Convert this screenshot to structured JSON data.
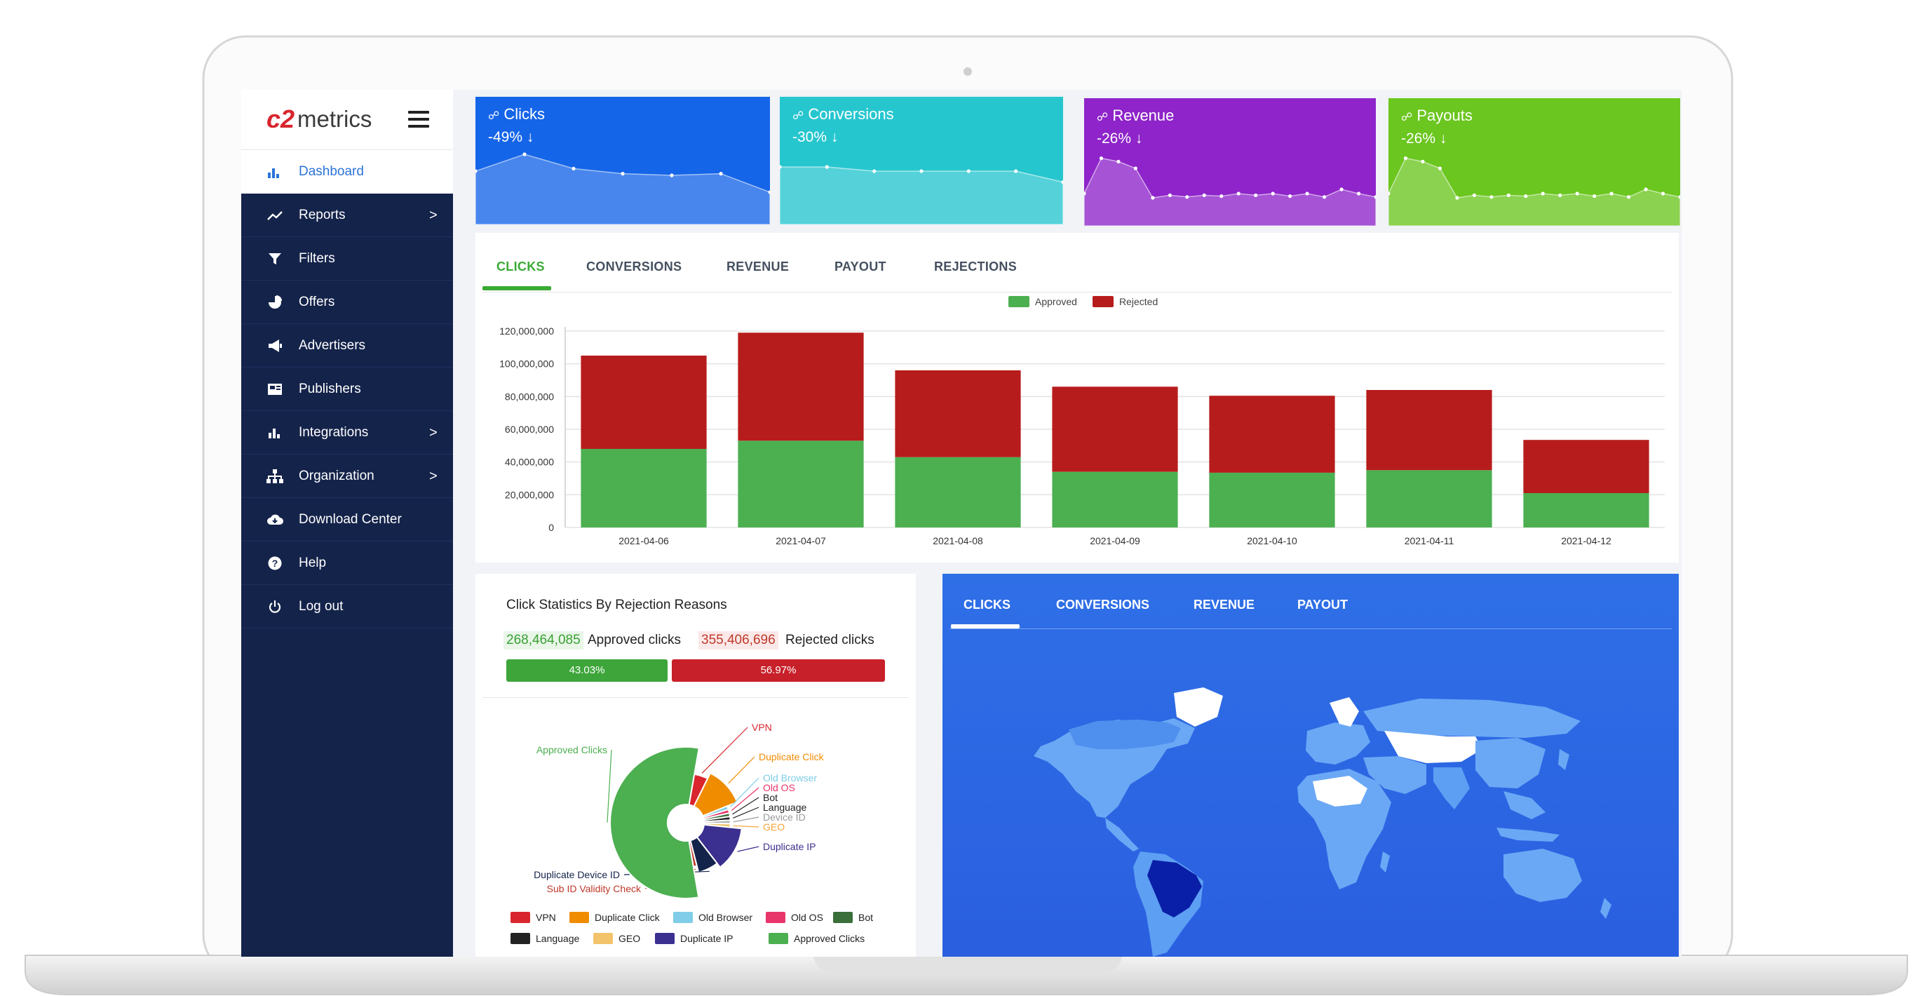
{
  "brand": {
    "mark": "c2",
    "word": "metrics"
  },
  "sidebar": {
    "active": "Dashboard",
    "items": [
      {
        "label": "Reports",
        "icon": "trend-icon",
        "chevron": ">"
      },
      {
        "label": "Filters",
        "icon": "filter-icon",
        "chevron": ""
      },
      {
        "label": "Offers",
        "icon": "pie-icon",
        "chevron": ""
      },
      {
        "label": "Advertisers",
        "icon": "megaphone-icon",
        "chevron": ""
      },
      {
        "label": "Publishers",
        "icon": "newspaper-icon",
        "chevron": ""
      },
      {
        "label": "Integrations",
        "icon": "bar-icon",
        "chevron": ">"
      },
      {
        "label": "Organization",
        "icon": "sitemap-icon",
        "chevron": ">"
      },
      {
        "label": "Download Center",
        "icon": "cloud-download-icon",
        "chevron": ""
      },
      {
        "label": "Help",
        "icon": "question-icon",
        "chevron": ""
      },
      {
        "label": "Log out",
        "icon": "power-icon",
        "chevron": ""
      }
    ]
  },
  "kpis": [
    {
      "title": "Clicks",
      "delta": "-49% ↓",
      "color": "#1565e8",
      "spark": [
        0.55,
        0.75,
        0.58,
        0.52,
        0.5,
        0.52,
        0.3
      ]
    },
    {
      "title": "Conversions",
      "delta": "-30% ↓",
      "color": "#26c6cf",
      "spark": [
        0.6,
        0.6,
        0.55,
        0.55,
        0.55,
        0.55,
        0.42
      ]
    },
    {
      "title": "Revenue",
      "delta": "-26% ↓",
      "color": "#8e24c9",
      "spark": [
        0.3,
        0.72,
        0.68,
        0.6,
        0.25,
        0.28,
        0.26,
        0.28,
        0.27,
        0.3,
        0.28,
        0.3,
        0.27,
        0.3,
        0.26,
        0.35,
        0.3,
        0.26
      ]
    },
    {
      "title": "Payouts",
      "delta": "-26% ↓",
      "color": "#6bc61f",
      "spark": [
        0.3,
        0.72,
        0.68,
        0.6,
        0.25,
        0.28,
        0.26,
        0.28,
        0.27,
        0.3,
        0.28,
        0.3,
        0.27,
        0.3,
        0.26,
        0.35,
        0.3,
        0.26
      ]
    }
  ],
  "tabs": {
    "items": [
      "CLICKS",
      "CONVERSIONS",
      "REVENUE",
      "PAYOUT",
      "REJECTIONS"
    ],
    "active": "CLICKS",
    "accent": "#3aaa35"
  },
  "chart_data": {
    "type": "bar",
    "stacked": true,
    "categories": [
      "2021-04-06",
      "2021-04-07",
      "2021-04-08",
      "2021-04-09",
      "2021-04-10",
      "2021-04-11",
      "2021-04-12"
    ],
    "series": [
      {
        "name": "Approved",
        "color": "#4caf50",
        "values": [
          48000000,
          53000000,
          43000000,
          34000000,
          33500000,
          35000000,
          21000000
        ]
      },
      {
        "name": "Rejected",
        "color": "#b71c1c",
        "values": [
          57000000,
          66000000,
          53000000,
          52000000,
          47000000,
          49000000,
          32500000
        ]
      }
    ],
    "ylim": [
      0,
      120000000
    ],
    "yticks": [
      "0",
      "20,000,000",
      "40,000,000",
      "60,000,000",
      "80,000,000",
      "100,000,000",
      "120,000,000"
    ],
    "legend": "top-center",
    "grid": true
  },
  "rejection": {
    "title": "Click Statistics By Rejection Reasons",
    "approved_count": "268,464,085",
    "approved_label": "Approved clicks",
    "rejected_count": "355,406,696",
    "rejected_label": "Rejected clicks",
    "approved_pct": "43.03%",
    "rejected_pct": "56.97%",
    "approved_fraction": 0.4303,
    "pie": [
      {
        "name": "VPN",
        "color": "#d9262e",
        "value": 3.5,
        "label_color": "#d9262e"
      },
      {
        "name": "Duplicate Click",
        "color": "#f08c00",
        "value": 9,
        "label_color": "#f08c00"
      },
      {
        "name": "Old Browser",
        "color": "#7fcde8",
        "value": 1,
        "label_color": "#7fcde8"
      },
      {
        "name": "Old OS",
        "color": "#e8356a",
        "value": 1,
        "label_color": "#e8356a"
      },
      {
        "name": "Bot",
        "color": "#3a6e3a",
        "value": 1,
        "label_color": "#222222"
      },
      {
        "name": "Language",
        "color": "#222222",
        "value": 1,
        "label_color": "#222222"
      },
      {
        "name": "Device ID",
        "color": "#b5b5b5",
        "value": 1,
        "label_color": "#9a9a9a"
      },
      {
        "name": "GEO",
        "color": "#f2c36b",
        "value": 1,
        "label_color": "#f2a43a"
      },
      {
        "name": "Duplicate IP",
        "color": "#3b2f8f",
        "value": 10,
        "label_color": "#3b2f8f"
      },
      {
        "name": "Duplicate Device ID",
        "color": "#14234a",
        "value": 5,
        "label_color": "#14234a"
      },
      {
        "name": "Sub ID Validity Check",
        "color": "#c0392b",
        "value": 1,
        "label_color": "#c0392b"
      },
      {
        "name": "Approved Clicks",
        "color": "#4caf50",
        "value": 43,
        "label_color": "#4caf50"
      }
    ],
    "legend": [
      {
        "name": "VPN",
        "color": "#d9262e"
      },
      {
        "name": "Duplicate Click",
        "color": "#f08c00"
      },
      {
        "name": "Old Browser",
        "color": "#7fcde8"
      },
      {
        "name": "Old OS",
        "color": "#e8356a"
      },
      {
        "name": "Bot",
        "color": "#3a6e3a"
      },
      {
        "name": "Language",
        "color": "#222222"
      },
      {
        "name": "GEO",
        "color": "#f2c36b"
      },
      {
        "name": "Duplicate IP",
        "color": "#3b2f8f"
      },
      {
        "name": "Approved Clicks",
        "color": "#4caf50"
      }
    ]
  },
  "map": {
    "tabs": [
      "CLICKS",
      "CONVERSIONS",
      "REVENUE",
      "PAYOUT"
    ],
    "active": "CLICKS",
    "colors": {
      "bg": "#2c66e3",
      "land": "#5c9ef3",
      "high": "#0a1fa8",
      "none": "#ffffff"
    }
  }
}
